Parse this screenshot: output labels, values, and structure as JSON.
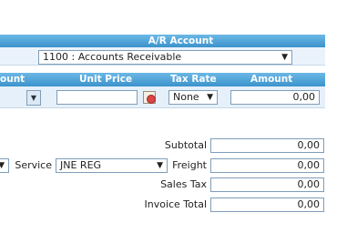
{
  "ar_account": {
    "header": "A/R Account",
    "selected": "1100 : Accounts Receivable"
  },
  "columns": {
    "amount_partial": "ount",
    "unit_price": "Unit Price",
    "tax_rate": "Tax Rate",
    "amount": "Amount"
  },
  "line": {
    "unit_price_value": "",
    "tax_rate_value": "None",
    "amount_value": "0,00"
  },
  "totals": {
    "subtotal_label": "Subtotal",
    "subtotal_value": "0,00",
    "service_label": "Service",
    "service_value": "JNE REG",
    "freight_label": "Freight",
    "freight_value": "0,00",
    "sales_tax_label": "Sales Tax",
    "sales_tax_value": "0,00",
    "invoice_total_label": "Invoice Total",
    "invoice_total_value": "0,00"
  },
  "icons": {
    "dropdown_arrow": "▼",
    "calendar": "calendar-icon"
  }
}
